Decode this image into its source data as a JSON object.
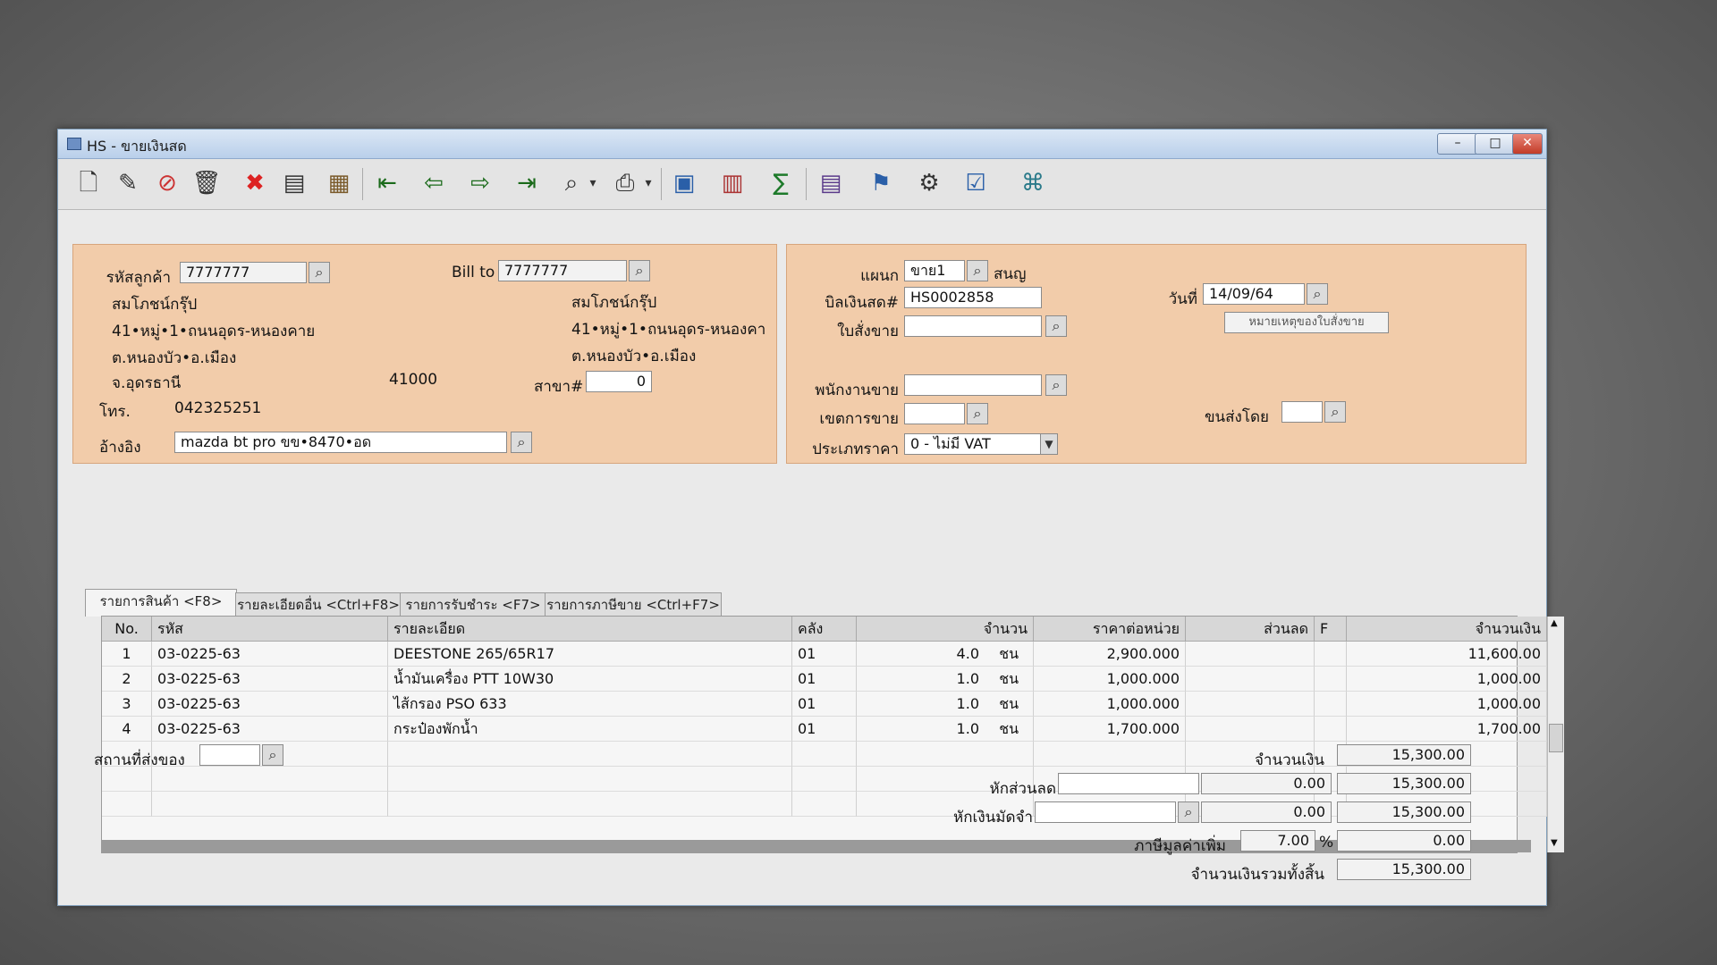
{
  "window": {
    "title": "HS - ขายเงินสด",
    "min_label": "–",
    "max_label": "□",
    "close_label": "✕"
  },
  "toolbar": {
    "icons": [
      "new-icon",
      "edit-icon",
      "void-icon",
      "delete-icon",
      "cancel-icon",
      "save-icon",
      "books-icon",
      "first-record-icon",
      "previous-record-icon",
      "next-record-icon",
      "last-record-icon",
      "find-icon",
      "print-icon",
      "note-icon",
      "form-icon",
      "sum-icon",
      "report-icon",
      "approve-icon",
      "tools-icon",
      "ok-icon",
      "network-icon"
    ]
  },
  "customer": {
    "code_label": "รหัสลูกค้า",
    "code_value": "7777777",
    "name": "สมโภชน์กรุ๊ป",
    "address1": "41•หมู่•1•ถนนอุดร-หนองคาย",
    "address2": "ต.หนองบัว•อ.เมือง",
    "province": "จ.อุดรธานี",
    "postcode": "41000",
    "phone_label": "โทร.",
    "phone": "042325251",
    "ref_label": "อ้างอิง",
    "ref_value": "mazda bt pro ขข•8470•อด"
  },
  "bill_to": {
    "label": "Bill to",
    "code_value": "7777777",
    "name": "สมโภชน์กรุ๊ป",
    "address1": "41•หมู่•1•ถนนอุดร-หนองคา",
    "address2": "ต.หนองบัว•อ.เมือง",
    "branch_label": "สาขา#",
    "branch_value": "0"
  },
  "doc": {
    "dept_label": "แผนก",
    "dept_value": "ขาย1",
    "dept_name": "สนญ",
    "bill_label": "บิลเงินสด#",
    "bill_value": "HS0002858",
    "date_label": "วันที่",
    "date_value": "14/09/64",
    "so_label": "ใบสั่งขาย",
    "so_value": "",
    "so_note_button": "หมายเหตุของใบสั่งขาย",
    "salesman_label": "พนักงานขาย",
    "salesman_value": "",
    "area_label": "เขตการขาย",
    "area_value": "",
    "ship_label": "ขนส่งโดย",
    "ship_value": "",
    "price_type_label": "ประเภทราคา",
    "price_type_value": "0 - ไม่มี VAT"
  },
  "tabs": [
    {
      "label": "รายการสินค้า <F8>"
    },
    {
      "label": "รายละเอียดอื่น <Ctrl+F8>"
    },
    {
      "label": "รายการรับชำระ <F7>"
    },
    {
      "label": "รายการภาษีขาย <Ctrl+F7>"
    }
  ],
  "grid": {
    "headers": [
      "No.",
      "รหัส",
      "รายละเอียด",
      "คลัง",
      "จำนวน",
      "ราคาต่อหน่วย",
      "ส่วนลด",
      "F",
      "จำนวนเงิน"
    ],
    "rows": [
      {
        "no": "1",
        "code": "03-0225-63",
        "desc": "DEESTONE 265/65R17",
        "wh": "01",
        "qty": "4.0",
        "unit": "ชน",
        "price": "2,900.000",
        "disc": "",
        "f": "",
        "amount": "11,600.00"
      },
      {
        "no": "2",
        "code": "03-0225-63",
        "desc": "น้ำมันเครื่อง PTT 10W30",
        "wh": "01",
        "qty": "1.0",
        "unit": "ชน",
        "price": "1,000.000",
        "disc": "",
        "f": "",
        "amount": "1,000.00"
      },
      {
        "no": "3",
        "code": "03-0225-63",
        "desc": "ไส้กรอง PSO 633",
        "wh": "01",
        "qty": "1.0",
        "unit": "ชน",
        "price": "1,000.000",
        "disc": "",
        "f": "",
        "amount": "1,000.00"
      },
      {
        "no": "4",
        "code": "03-0225-63",
        "desc": "กระป๋องพักน้ำ",
        "wh": "01",
        "qty": "1.0",
        "unit": "ชน",
        "price": "1,700.000",
        "disc": "",
        "f": "",
        "amount": "1,700.00"
      }
    ]
  },
  "footer": {
    "ship_place_label": "สถานที่ส่งของ",
    "ship_place_value": "",
    "amount_label": "จำนวนเงิน",
    "amount_value": "15,300.00",
    "discount_label": "หักส่วนลด",
    "discount_input": "",
    "discount_value": "0.00",
    "discount_total": "15,300.00",
    "deposit_label": "หักเงินมัดจำ",
    "deposit_input": "",
    "deposit_value": "0.00",
    "deposit_total": "15,300.00",
    "vat_label": "ภาษีมูลค่าเพิ่ม",
    "vat_rate": "7.00",
    "vat_pct": "%",
    "vat_value": "0.00",
    "grand_label": "จำนวนเงินรวมทั้งสิ้น",
    "grand_value": "15,300.00"
  }
}
